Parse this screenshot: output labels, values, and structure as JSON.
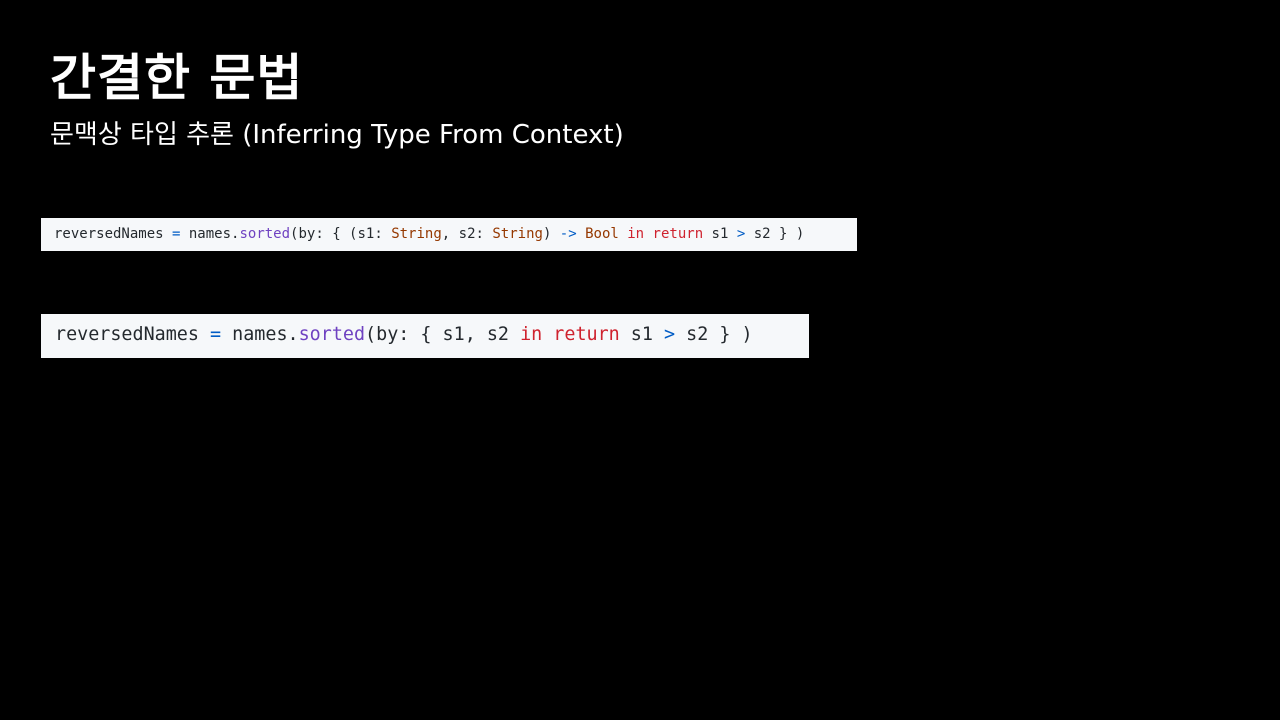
{
  "slide": {
    "title": "간결한 문법",
    "subtitle": "문맥상 타입 추론 (Inferring Type From Context)"
  },
  "code_blocks": [
    {
      "tokens": [
        {
          "text": "reversedNames",
          "kind": "plain"
        },
        {
          "text": " ",
          "kind": "plain"
        },
        {
          "text": "=",
          "kind": "op"
        },
        {
          "text": " names.",
          "kind": "plain"
        },
        {
          "text": "sorted",
          "kind": "fn"
        },
        {
          "text": "(by: { (s1: ",
          "kind": "plain"
        },
        {
          "text": "String",
          "kind": "type"
        },
        {
          "text": ", s2: ",
          "kind": "plain"
        },
        {
          "text": "String",
          "kind": "type"
        },
        {
          "text": ") ",
          "kind": "plain"
        },
        {
          "text": "->",
          "kind": "op"
        },
        {
          "text": " ",
          "kind": "plain"
        },
        {
          "text": "Bool",
          "kind": "type"
        },
        {
          "text": " ",
          "kind": "plain"
        },
        {
          "text": "in",
          "kind": "kw"
        },
        {
          "text": " ",
          "kind": "plain"
        },
        {
          "text": "return",
          "kind": "kw"
        },
        {
          "text": " s1 ",
          "kind": "plain"
        },
        {
          "text": ">",
          "kind": "op"
        },
        {
          "text": " s2 } )",
          "kind": "plain"
        }
      ]
    },
    {
      "tokens": [
        {
          "text": "reversedNames",
          "kind": "plain"
        },
        {
          "text": " ",
          "kind": "plain"
        },
        {
          "text": "=",
          "kind": "op"
        },
        {
          "text": " names.",
          "kind": "plain"
        },
        {
          "text": "sorted",
          "kind": "fn"
        },
        {
          "text": "(by: { s1, s2 ",
          "kind": "plain"
        },
        {
          "text": "in",
          "kind": "kw"
        },
        {
          "text": " ",
          "kind": "plain"
        },
        {
          "text": "return",
          "kind": "kw"
        },
        {
          "text": " s1 ",
          "kind": "plain"
        },
        {
          "text": ">",
          "kind": "op"
        },
        {
          "text": " s2 } )",
          "kind": "plain"
        }
      ]
    }
  ],
  "colors": {
    "background": "#000000",
    "text": "#ffffff",
    "code_background": "#f6f8fa",
    "code_plain": "#24292e",
    "code_operator": "#005cc5",
    "code_function": "#6f42c1",
    "code_type": "#953800",
    "code_keyword": "#cf222e"
  }
}
